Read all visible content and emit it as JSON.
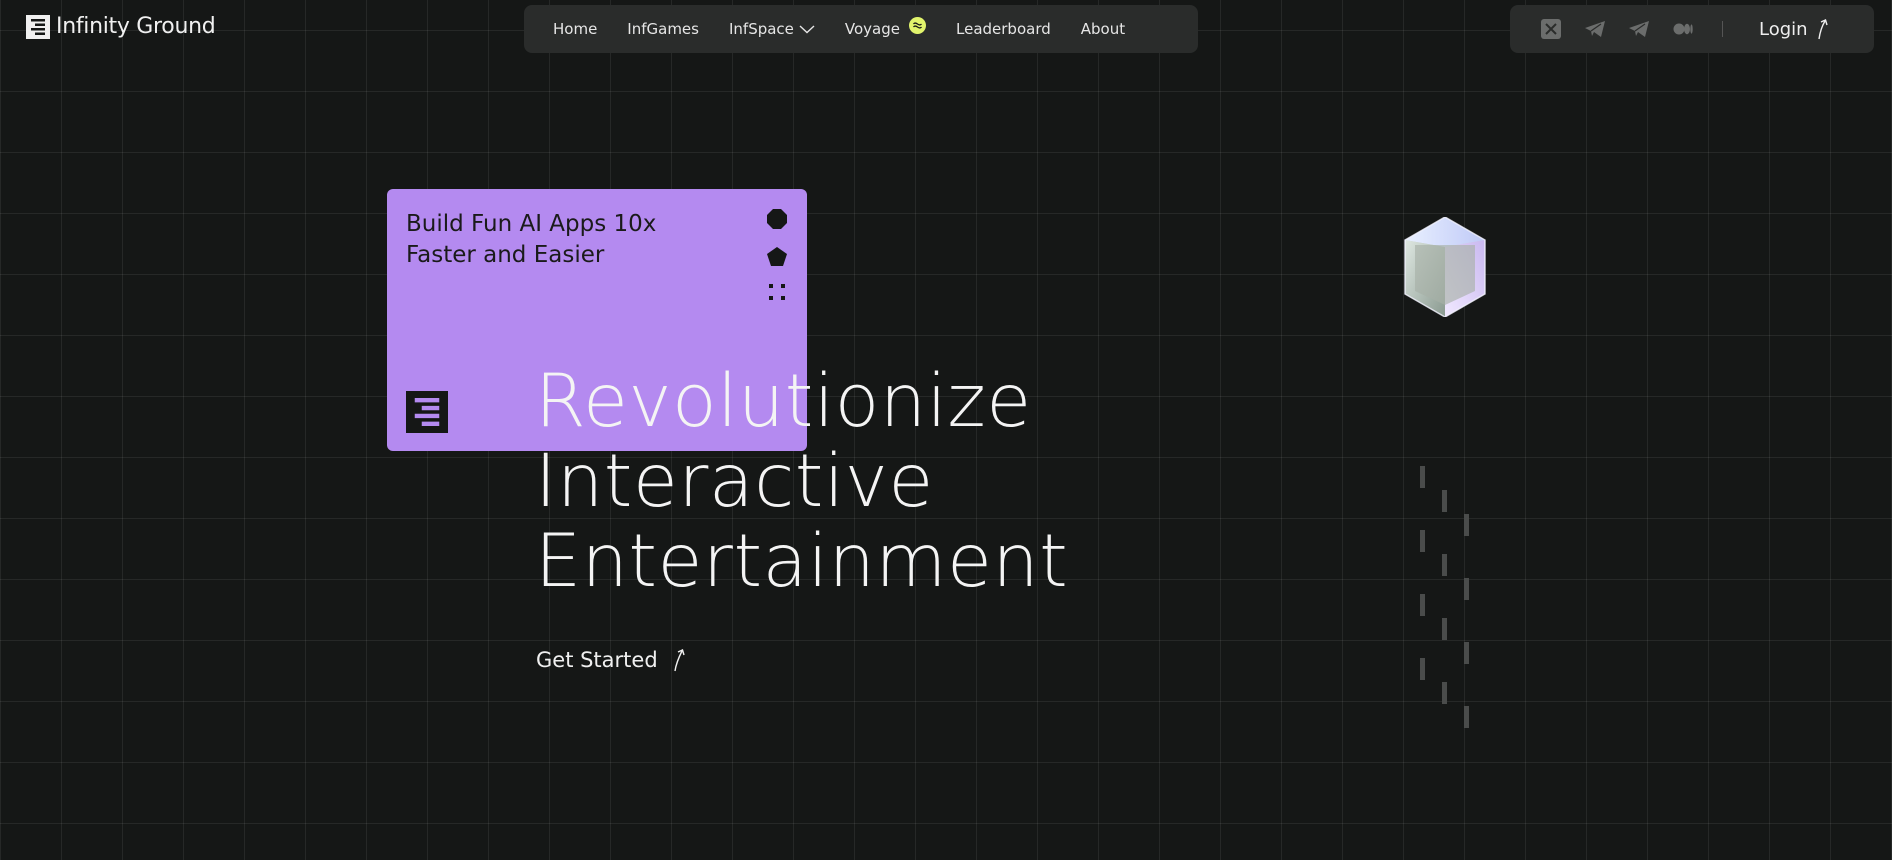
{
  "brand": {
    "name": "Infinity Ground"
  },
  "nav": {
    "items": [
      {
        "label": "Home"
      },
      {
        "label": "InfGames"
      },
      {
        "label": "InfSpace"
      },
      {
        "label": "Voyage"
      },
      {
        "label": "Leaderboard"
      },
      {
        "label": "About"
      }
    ]
  },
  "social": {
    "icons": [
      "x-icon",
      "telegram-icon",
      "telegram-icon",
      "medium-icon"
    ],
    "login_label": "Login"
  },
  "card": {
    "title": "Build Fun AI Apps 10x\nFaster and Easier",
    "background": "#b48af0"
  },
  "hero": {
    "lines": [
      "Revolutionize",
      "Interactive",
      "Entertainment"
    ],
    "cta_label": "Get Started"
  },
  "colors": {
    "background": "#151716",
    "badge": "#e1f46c",
    "card": "#b48af0"
  }
}
